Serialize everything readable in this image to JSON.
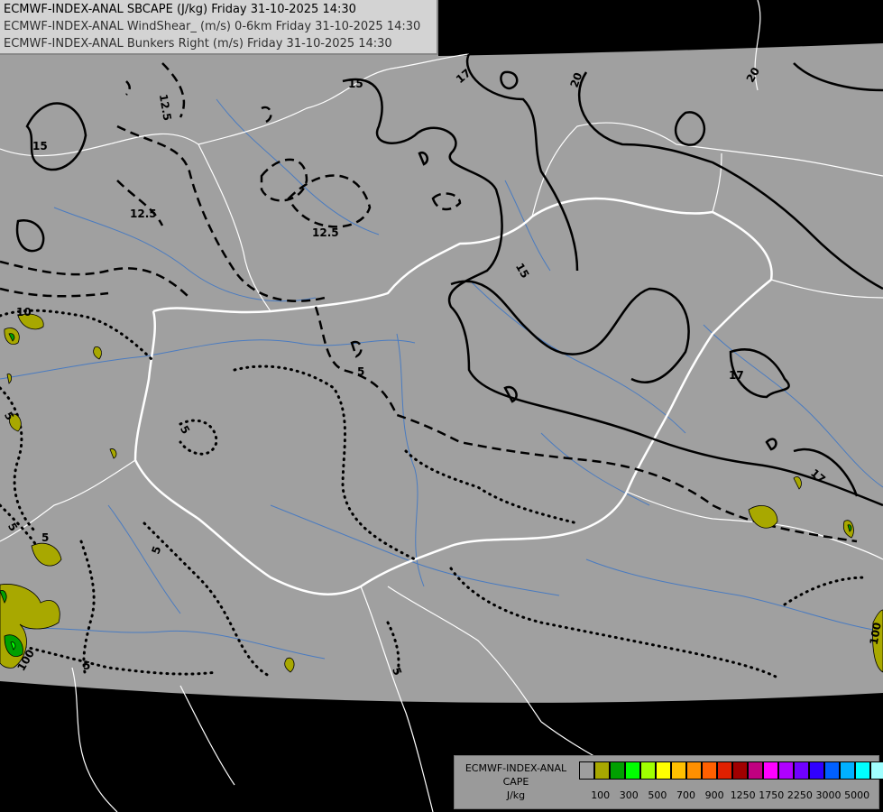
{
  "header": {
    "line1": "ECMWF-INDEX-ANAL SBCAPE (J/kg) Friday 31-10-2025 14:30",
    "line2": "ECMWF-INDEX-ANAL WindShear_ (m/s) 0-6km Friday 31-10-2025 14:30",
    "line3": "ECMWF-INDEX-ANAL Bunkers Right (m/s) Friday 31-10-2025 14:30"
  },
  "legend": {
    "title_line1": "ECMWF-INDEX-ANAL",
    "title_line2": "CAPE",
    "title_line3": "J/kg",
    "swatch_colors": [
      "#9e9e9e",
      "#a8a800",
      "#00a000",
      "#00ff00",
      "#a0ff00",
      "#ffff00",
      "#ffc000",
      "#ff9000",
      "#ff6000",
      "#e02000",
      "#a00000",
      "#c00080",
      "#ff00ff",
      "#b000ff",
      "#7000ff",
      "#3000ff",
      "#0060ff",
      "#00b0ff",
      "#00ffff",
      "#a0ffff",
      "#ffffff"
    ],
    "ticks": [
      "100",
      "300",
      "500",
      "700",
      "900",
      "1250",
      "1750",
      "2250",
      "3000",
      "5000"
    ]
  },
  "contour_labels": {
    "shear": [
      "15",
      "12.5",
      "12.5",
      "12.5",
      "15",
      "20",
      "20",
      "15",
      "17",
      "17",
      "17",
      "10"
    ],
    "bunkers": [
      "5",
      "5",
      "5",
      "5",
      "5",
      "5",
      "5",
      "100",
      "100",
      "5"
    ]
  }
}
